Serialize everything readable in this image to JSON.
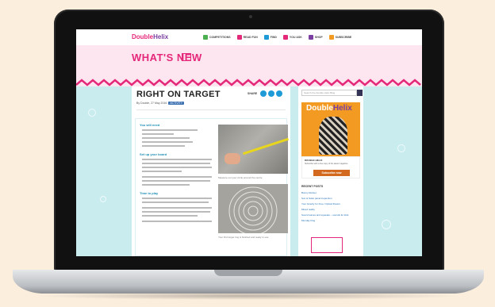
{
  "site": {
    "logo_double": "Double",
    "logo_helix": "Helix",
    "nav": [
      {
        "label": "COMPETITIONS",
        "color": "#4caf50"
      },
      {
        "label": "READ FUN",
        "color": "#e5297a"
      },
      {
        "label": "FIND",
        "color": "#1e9bd7"
      },
      {
        "label": "YOU ASK",
        "color": "#e5297a"
      },
      {
        "label": "SHOP",
        "color": "#7a3fa0"
      },
      {
        "label": "SUBSCRIBE",
        "color": "#f29a22"
      }
    ],
    "hero_title": "WHAT'S NEW"
  },
  "article": {
    "title": "RIGHT ON TARGET",
    "byline": "By Double, 27 May 2016",
    "tag": "ACTIVITY",
    "share_label": "SHARE",
    "section1": "You will need",
    "section2": "Set up your board",
    "section3": "Time to play",
    "caption1": "Measure out your circle around the centre",
    "caption2": "Your first target ring is finished and ready to use"
  },
  "sidebar": {
    "search_placeholder": "Search the Double Helix Blog",
    "mag_title_double": "Double",
    "mag_title_helix": "Helix",
    "subscribe_heading": "DOUBLE HELIX",
    "subscribe_text": "Subscribe with a free copy of the latest magazine",
    "subscribe_button": "Subscribe now",
    "recent_heading": "RECENT POSTS",
    "recent_posts": [
      "Bunny Rocket",
      "Sun & Solar panel inspection",
      "Your Gravity for Free: Optical Illusion",
      "Mixed reality",
      "Sound waves and squeaks – sounds for kids",
      "Monday blog"
    ]
  }
}
